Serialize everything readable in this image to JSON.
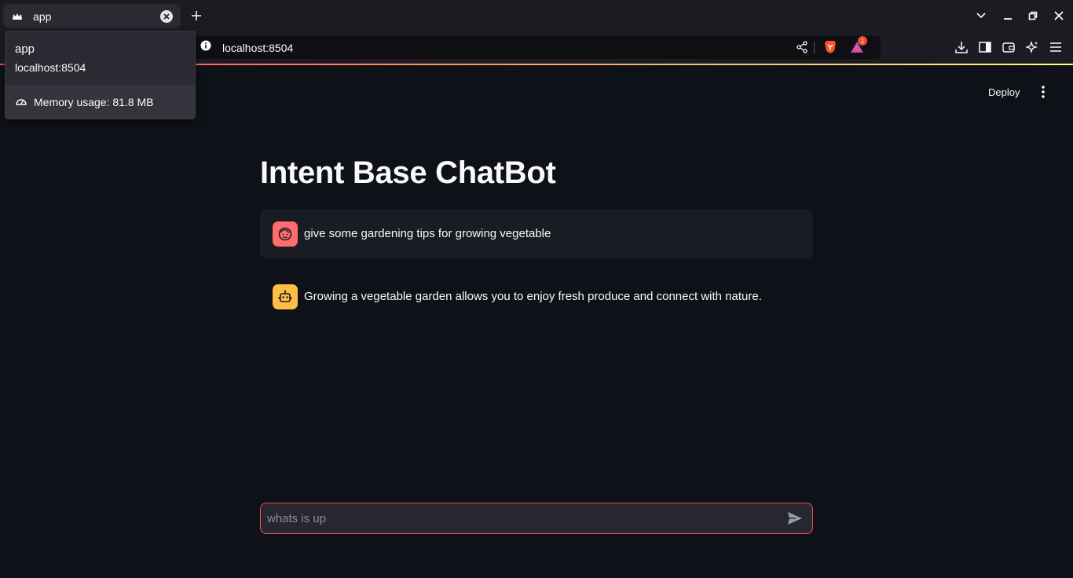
{
  "browser": {
    "tab_title": "app",
    "url": "localhost:8504",
    "notification_count": "1"
  },
  "popup": {
    "title": "app",
    "url": "localhost:8504",
    "memory": "Memory usage: 81.8 MB"
  },
  "app": {
    "deploy_label": "Deploy",
    "title": "Intent Base ChatBot"
  },
  "messages": [
    {
      "role": "user",
      "text": "give some gardening tips for growing vegetable"
    },
    {
      "role": "assistant",
      "text": "Growing a vegetable garden allows you to enjoy fresh produce and connect with nature."
    }
  ],
  "chat_input": {
    "placeholder": "whats is up"
  },
  "colors": {
    "accent": "#ff4b4b",
    "background": "#0e1117",
    "user_avatar": "#ff6c6c",
    "bot_avatar": "#ffbd45"
  }
}
